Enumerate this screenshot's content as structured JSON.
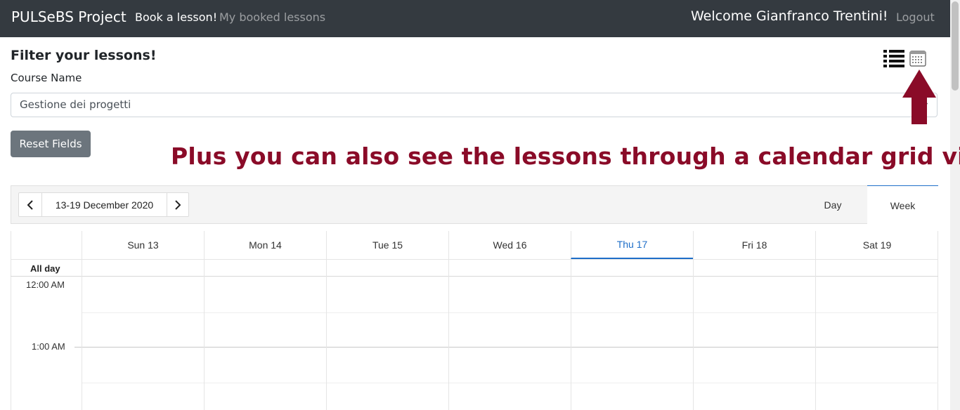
{
  "navbar": {
    "brand": "PULSeBS Project",
    "book_lesson": "Book a lesson!",
    "booked_lessons": "My booked lessons",
    "welcome": "Welcome Gianfranco Trentini!",
    "logout": "Logout"
  },
  "filter": {
    "title": "Filter your lessons!",
    "course_label": "Course Name",
    "course_value": "Gestione dei progetti",
    "reset_label": "Reset Fields"
  },
  "view_toggle": {
    "list_icon": "list-icon",
    "calendar_icon": "calendar-icon"
  },
  "annotation": {
    "text": "Plus you can also see the lessons through a calendar grid view",
    "color": "#8a0b28"
  },
  "calendar": {
    "range": "13-19 December 2020",
    "views": [
      "Day",
      "Week"
    ],
    "active_view": "Week",
    "days": [
      {
        "label": "Sun 13",
        "today": false
      },
      {
        "label": "Mon 14",
        "today": false
      },
      {
        "label": "Tue 15",
        "today": false
      },
      {
        "label": "Wed 16",
        "today": false
      },
      {
        "label": "Thu 17",
        "today": true
      },
      {
        "label": "Fri 18",
        "today": false
      },
      {
        "label": "Sat 19",
        "today": false
      }
    ],
    "all_day_label": "All day",
    "times": [
      "12:00 AM",
      "1:00 AM"
    ]
  },
  "colors": {
    "navbar": "#343a40",
    "accent": "#1e6ec8",
    "reset_button": "#6c757d"
  }
}
